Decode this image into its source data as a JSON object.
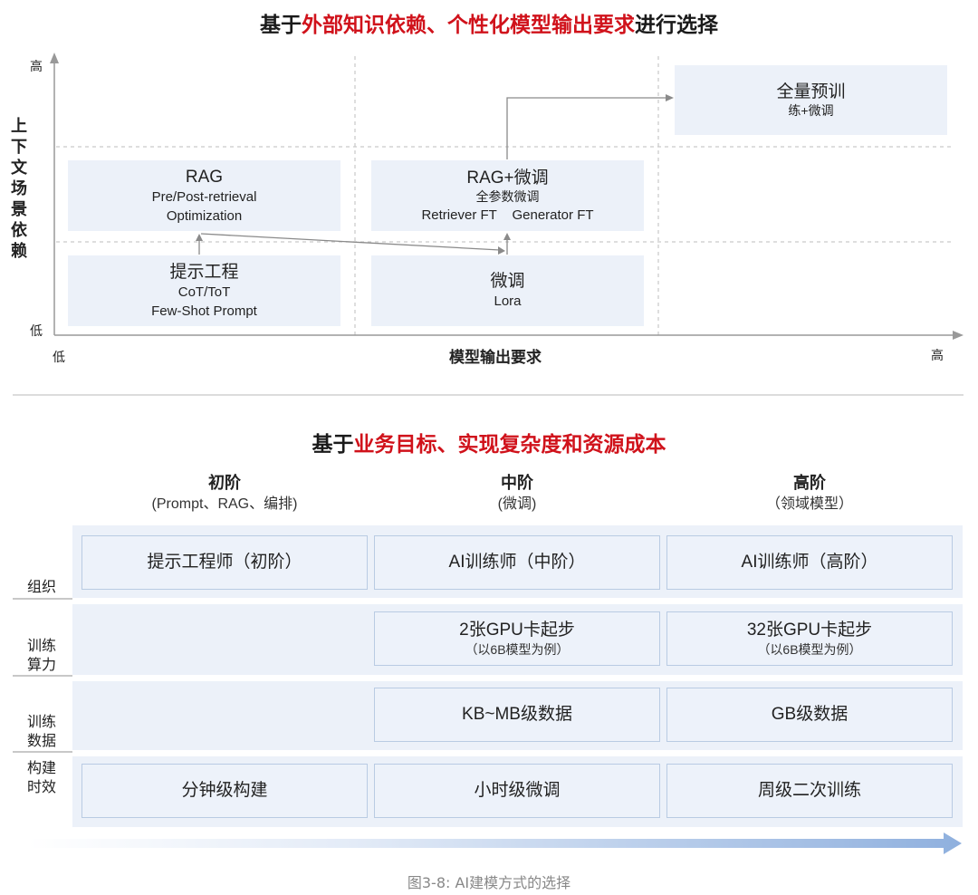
{
  "top": {
    "title_pre": "基于",
    "title_hl": "外部知识依赖、个性化模型输出要求",
    "title_post": "进行选择",
    "y_high": "高",
    "y_low": "低",
    "y_label": [
      "上",
      "下",
      "文",
      "场",
      "景",
      "依",
      "赖"
    ],
    "x_low": "低",
    "x_high": "高",
    "x_label": "模型输出要求",
    "boxes": {
      "rag": {
        "title": "RAG",
        "line1": "Pre/Post-retrieval",
        "line2": "Optimization"
      },
      "prompt": {
        "title": "提示工程",
        "line1": "CoT/ToT",
        "line2": "Few-Shot Prompt"
      },
      "ragft": {
        "title": "RAG+微调",
        "line1": "全参数微调",
        "line2a": "Retriever FT",
        "line2b": "Generator FT"
      },
      "ft": {
        "title": "微调",
        "line1": "Lora"
      },
      "full": {
        "title": "全量预训",
        "line1": "练+微调"
      }
    }
  },
  "bottom": {
    "title_pre": "基于",
    "title_hl": "业务目标、实现复杂度和资源成本",
    "columns": [
      {
        "title": "初阶",
        "sub": "(Prompt、RAG、编排)"
      },
      {
        "title": "中阶",
        "sub": "(微调)"
      },
      {
        "title": "高阶",
        "sub": "（领域模型）"
      }
    ],
    "rows": {
      "org": {
        "label": "组织",
        "cells": [
          "提示工程师（初阶）",
          "AI训练师（中阶）",
          "AI训练师（高阶）"
        ]
      },
      "compute": {
        "label1": "训练",
        "label2": "算力",
        "mid": {
          "c1": "2张GPU卡起步",
          "c2": "（以6B模型为例）"
        },
        "high": {
          "c1": "32张GPU卡起步",
          "c2": "（以6B模型为例）"
        }
      },
      "data": {
        "label1": "训练",
        "label2": "数据",
        "mid": "KB~MB级数据",
        "high": "GB级数据"
      },
      "time": {
        "label1": "构建",
        "label2": "时效",
        "cells": [
          "分钟级构建",
          "小时级微调",
          "周级二次训练"
        ]
      }
    }
  },
  "caption": "图3-8: AI建模方式的选择",
  "colors": {
    "accent": "#d0121b",
    "box": "#ecf1f9",
    "border": "#b9cbe3",
    "arrow": "#9ab3d9"
  }
}
